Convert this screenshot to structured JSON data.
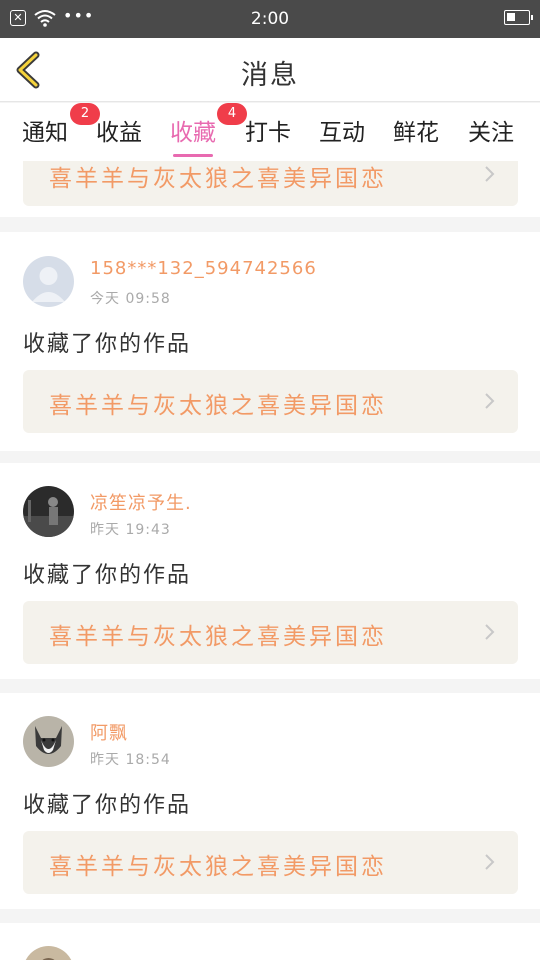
{
  "status_bar": {
    "time": "2:00",
    "dots": "•••"
  },
  "header": {
    "title": "消息"
  },
  "tabs": [
    {
      "label": "通知",
      "badge": "2"
    },
    {
      "label": "收益"
    },
    {
      "label": "收藏",
      "badge": "4",
      "active": true
    },
    {
      "label": "打卡"
    },
    {
      "label": "互动"
    },
    {
      "label": "鲜花"
    },
    {
      "label": "关注"
    }
  ],
  "work_title": "喜羊羊与灰太狼之喜美异国恋",
  "messages": [
    {
      "user": "158***132_594742566",
      "time": "今天 09:58",
      "action": "收藏了你的作品",
      "work": "喜羊羊与灰太狼之喜美异国恋"
    },
    {
      "user": "凉笙凉予生.",
      "time": "昨天 19:43",
      "action": "收藏了你的作品",
      "work": "喜羊羊与灰太狼之喜美异国恋"
    },
    {
      "user": "阿飘",
      "time": "昨天 18:54",
      "action": "收藏了你的作品",
      "work": "喜羊羊与灰太狼之喜美异国恋"
    }
  ],
  "colors": {
    "accent": "#e86ab0",
    "badge": "#f03d4a",
    "name": "#f29a66",
    "status_bar": "#4a4a4a"
  },
  "icons": [
    "close-icon",
    "wifi-icon",
    "battery-icon",
    "back-chevron-icon",
    "chevron-right-icon"
  ]
}
